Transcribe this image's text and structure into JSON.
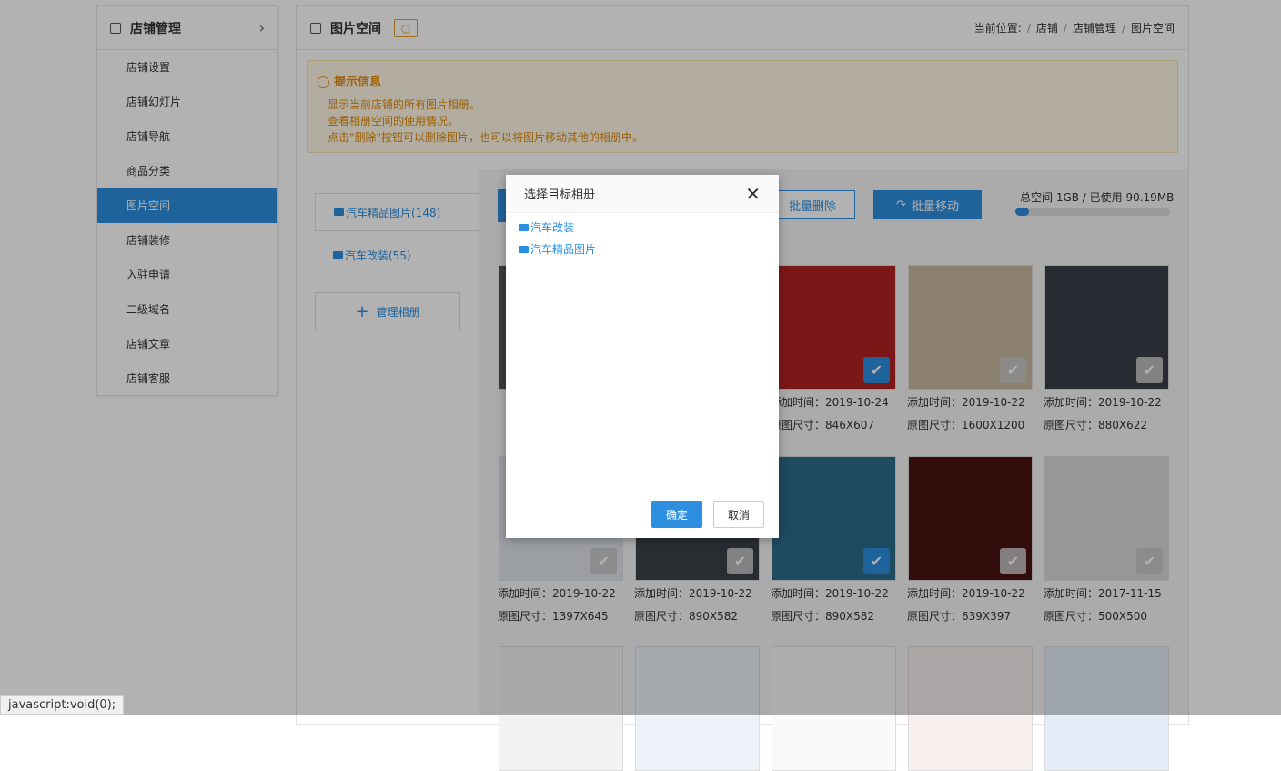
{
  "sidebar": {
    "title": "店铺管理",
    "items": [
      {
        "label": "店铺设置"
      },
      {
        "label": "店铺幻灯片"
      },
      {
        "label": "店铺导航"
      },
      {
        "label": "商品分类"
      },
      {
        "label": "图片空间",
        "active": true
      },
      {
        "label": "店铺装修"
      },
      {
        "label": "入驻申请"
      },
      {
        "label": "二级域名"
      },
      {
        "label": "店铺文章"
      },
      {
        "label": "店铺客服"
      }
    ]
  },
  "header": {
    "title": "图片空间",
    "breadcrumb_prefix": "当前位置:",
    "breadcrumb": [
      "店铺",
      "店铺管理",
      "图片空间"
    ]
  },
  "tips": {
    "title": "提示信息",
    "lines": [
      "显示当前店铺的所有图片相册。",
      "查看相册空间的使用情况。",
      "点击\"删除\"按钮可以删除图片，也可以将图片移动其他的相册中。"
    ]
  },
  "albums": [
    {
      "label": "汽车精品图片(148)"
    },
    {
      "label": "汽车改装(55)"
    }
  ],
  "manage_album": "管理相册",
  "toolbar": {
    "batch_delete": "批量删除",
    "batch_move": "批量移动",
    "storage_text": "总空间 1GB / 已使用 90.19MB",
    "storage_used_fraction": 0.088
  },
  "images": [
    {
      "time": "2019-10-24",
      "size": "846X607",
      "checked": true,
      "color": "#b22222"
    },
    {
      "time": "2019-10-22",
      "size": "1600X1200",
      "checked": false,
      "color": "#c9b8a0"
    },
    {
      "time": "2019-10-22",
      "size": "880X622",
      "checked": false,
      "color": "#3a3f48"
    },
    {
      "time": "2019-10-22",
      "size": "1397X645",
      "checked": false,
      "color": "#dfe3ea"
    },
    {
      "time": "2019-10-22",
      "size": "890X582",
      "checked": false,
      "color": "#3c4148"
    },
    {
      "time": "2019-10-22",
      "size": "890X582",
      "checked": true,
      "color": "#2b6c8a"
    },
    {
      "time": "2019-10-22",
      "size": "639X397",
      "checked": false,
      "color": "#4a1212"
    },
    {
      "time": "2017-11-15",
      "size": "500X500",
      "checked": false,
      "color": "#d8d8d8"
    }
  ],
  "meta_labels": {
    "time": "添加时间：",
    "size": "原图尺寸："
  },
  "modal": {
    "title": "选择目标相册",
    "items": [
      "汽车改装",
      "汽车精品图片"
    ],
    "ok": "确定",
    "cancel": "取消"
  },
  "statusbar": "javascript:void(0);"
}
